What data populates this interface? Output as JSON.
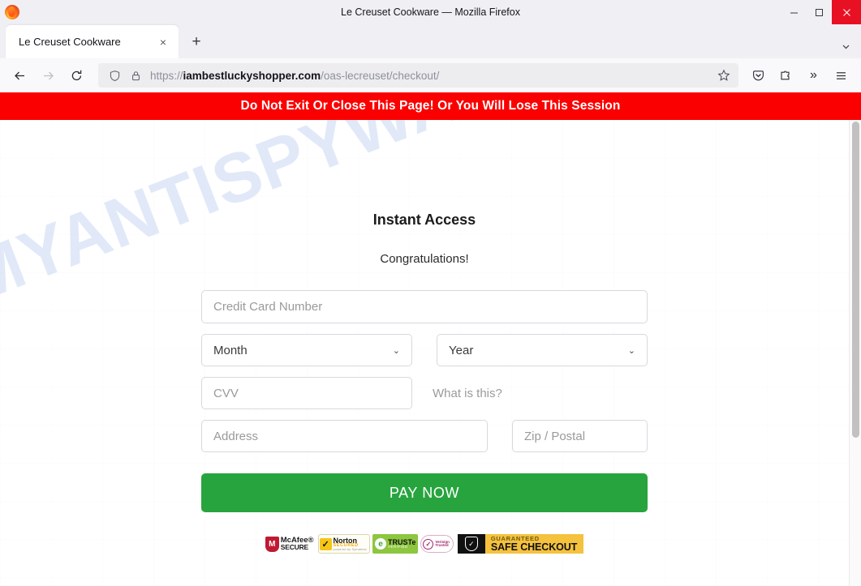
{
  "window": {
    "title": "Le Creuset Cookware — Mozilla Firefox",
    "minimize_label": "Minimize",
    "maximize_label": "Maximize",
    "close_label": "Close"
  },
  "tabs": {
    "items": [
      {
        "label": "Le Creuset Cookware",
        "close_label": "×"
      }
    ],
    "new_tab_label": "+",
    "list_all_tabs_label": "⌄"
  },
  "toolbar": {
    "back_label": "←",
    "forward_label": "→",
    "reload_label": "⟳",
    "url_scheme": "https://",
    "url_domain": "iambestluckyshopper.com",
    "url_path": "/oas-lecreuset/checkout/",
    "bookmark_label": "☆",
    "pocket_label": "Save to Pocket",
    "extensions_label": "Extensions",
    "overflow_label": "»",
    "menu_label": "≡"
  },
  "banner": {
    "text": "Do Not Exit Or Close This Page! Or You Will Lose This Session",
    "background": "#fb0000",
    "color": "#ffffff"
  },
  "watermark": {
    "text": "MYANTISPYWARE.COM",
    "color": "#cfdcf5"
  },
  "page": {
    "headline": "Instant Access",
    "subhead": "Congratulations!",
    "fields": {
      "card_number_placeholder": "Credit Card Number",
      "month_value": "Month",
      "year_value": "Year",
      "cvv_placeholder": "CVV",
      "what_is_this": "What is this?",
      "address_placeholder": "Address",
      "zip_placeholder": "Zip / Postal"
    },
    "pay_button": {
      "label": "PAY NOW",
      "color": "#28a43f"
    },
    "badges": [
      {
        "id": "mcafee",
        "line1": "McAfee®",
        "line2": "SECURE",
        "mark": "M"
      },
      {
        "id": "norton",
        "line1": "Norton",
        "line2": "SECURED",
        "line3": "powered by Symantec",
        "mark": "✓"
      },
      {
        "id": "truste",
        "line1": "TRUSTe",
        "line2": "VERIFIED",
        "mark": "e"
      },
      {
        "id": "verified",
        "line1": "Verisign",
        "line2": "Trusted",
        "mark": "✓"
      },
      {
        "id": "safe-checkout",
        "line1": "GUARANTEED",
        "line2": "SAFE CHECKOUT",
        "mark": "✓"
      }
    ]
  }
}
